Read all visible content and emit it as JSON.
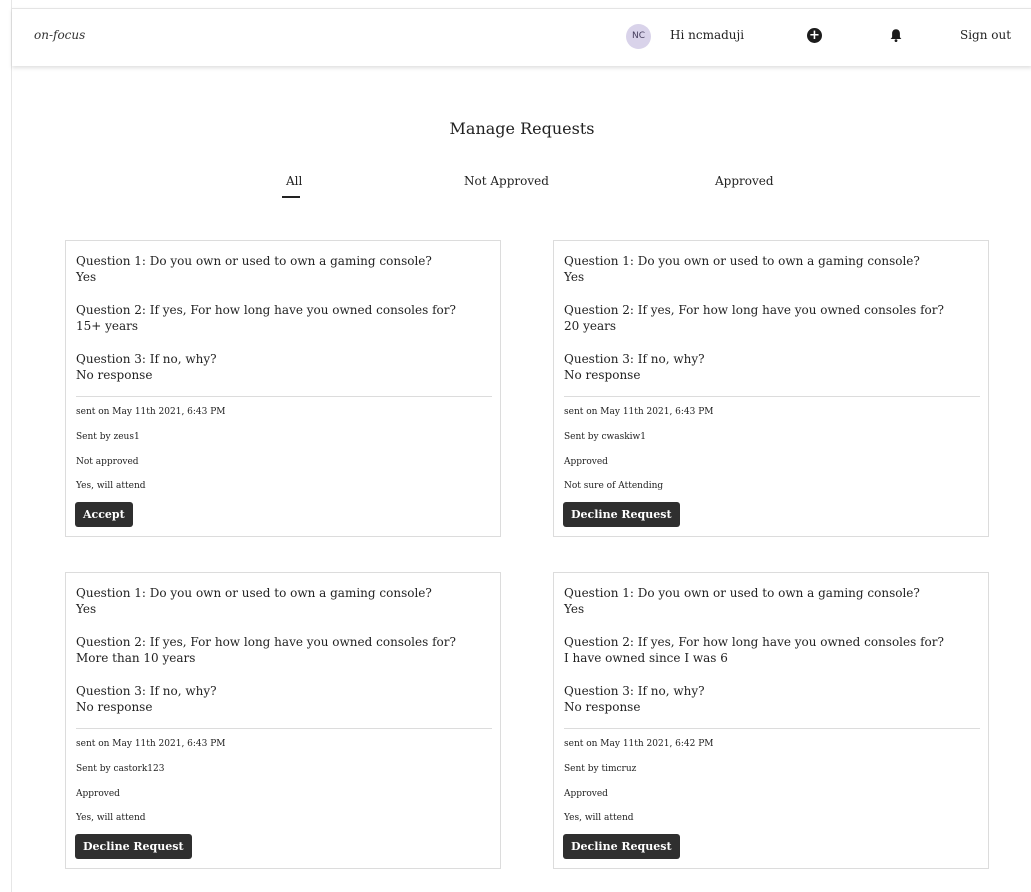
{
  "app": {
    "logo": "on-focus"
  },
  "header": {
    "avatar_initials": "NC",
    "greeting": "Hi ncmaduji",
    "add_icon": "plus-circle-icon",
    "notification_icon": "bell-icon",
    "signout_label": "Sign out"
  },
  "page": {
    "title": "Manage Requests",
    "tabs": [
      {
        "label": "All",
        "active": true
      },
      {
        "label": "Not Approved",
        "active": false
      },
      {
        "label": "Approved",
        "active": false
      }
    ]
  },
  "requests": [
    {
      "q1": "Question 1: Do you own or used to own a gaming console?",
      "a1": "Yes",
      "q2": "Question 2: If yes, For how long have you owned consoles for?",
      "a2": "15+ years",
      "q3": "Question 3: If no, why?",
      "a3": "No response",
      "sent": "sent on May 11th 2021, 6:43 PM",
      "sender": "Sent by zeus1",
      "status": "Not approved",
      "attendance": "Yes, will attend",
      "action": "Accept"
    },
    {
      "q1": "Question 1: Do you own or used to own a gaming console?",
      "a1": "Yes",
      "q2": "Question 2: If yes, For how long have you owned consoles for?",
      "a2": "20 years",
      "q3": "Question 3: If no, why?",
      "a3": "No response",
      "sent": "sent on May 11th 2021, 6:43 PM",
      "sender": "Sent by cwaskiw1",
      "status": "Approved",
      "attendance": "Not sure of Attending",
      "action": "Decline Request"
    },
    {
      "q1": "Question 1: Do you own or used to own a gaming console?",
      "a1": "Yes",
      "q2": "Question 2: If yes, For how long have you owned consoles for?",
      "a2": "More than 10 years",
      "q3": "Question 3: If no, why?",
      "a3": "No response",
      "sent": "sent on May 11th 2021, 6:43 PM",
      "sender": "Sent by castork123",
      "status": "Approved",
      "attendance": "Yes, will attend",
      "action": "Decline Request"
    },
    {
      "q1": "Question 1: Do you own or used to own a gaming console?",
      "a1": "Yes",
      "q2": "Question 2: If yes, For how long have you owned consoles for?",
      "a2": "I have owned since I was 6",
      "q3": "Question 3: If no, why?",
      "a3": "No response",
      "sent": "sent on May 11th 2021, 6:42 PM",
      "sender": "Sent by timcruz",
      "status": "Approved",
      "attendance": "Yes, will attend",
      "action": "Decline Request"
    }
  ]
}
